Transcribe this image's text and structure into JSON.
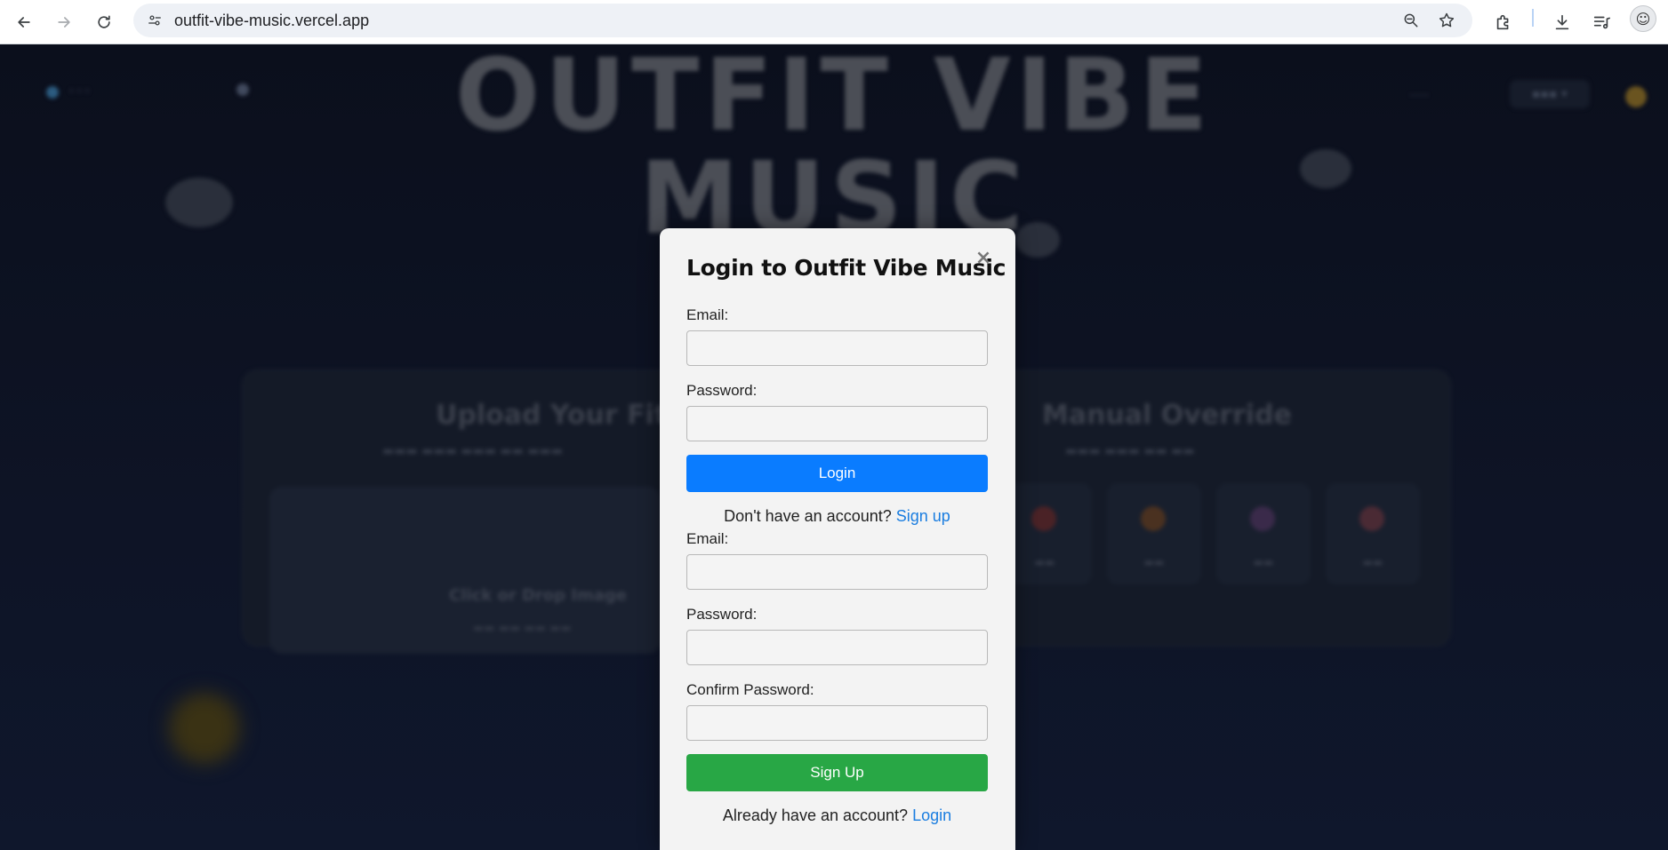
{
  "browser": {
    "url": "outfit-vibe-music.vercel.app"
  },
  "background": {
    "hero_title_line1": "OUTFIT VIBE",
    "hero_title_line2": "MUSIC",
    "upload_heading": "Upload Your Fit",
    "manual_heading": "Manual Override",
    "drop_title": "Click or Drop Image"
  },
  "modal": {
    "title": "Login to Outfit Vibe Music",
    "close_symbol": "×",
    "login_form": {
      "email_label": "Email:",
      "email_value": "",
      "password_label": "Password:",
      "password_value": "",
      "submit_label": "Login",
      "switch_text": "Don't have an account?",
      "switch_link": "Sign up"
    },
    "signup_form": {
      "email_label": "Email:",
      "email_value": "",
      "password_label": "Password:",
      "password_value": "",
      "confirm_label": "Confirm Password:",
      "confirm_value": "",
      "submit_label": "Sign Up",
      "switch_text": "Already have an account?",
      "switch_link": "Login"
    }
  },
  "colors": {
    "login_button": "#0a7cff",
    "signup_button": "#28a745",
    "link": "#1a7de0",
    "modal_bg": "#f3f3f3",
    "page_bg": "#0d1220"
  }
}
